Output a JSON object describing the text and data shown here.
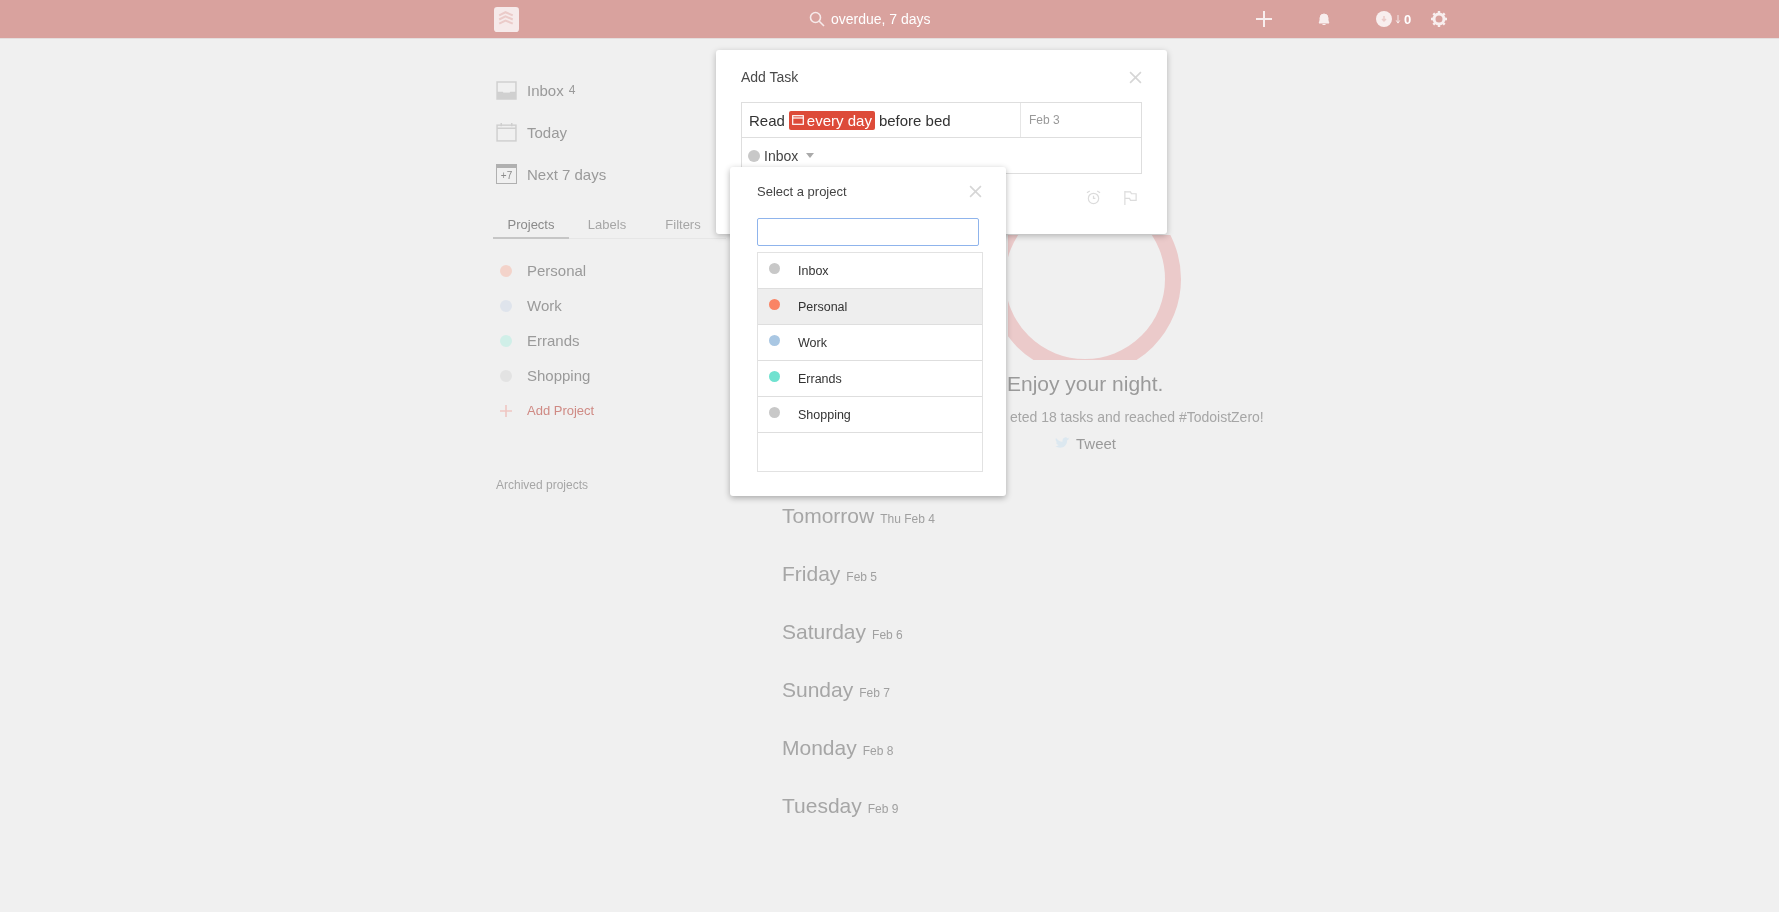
{
  "top_bar": {
    "search": {
      "placeholder": "overdue, 7 days"
    },
    "karma": "0"
  },
  "sidebar": {
    "nav": [
      {
        "kind": "inbox",
        "label": "Inbox",
        "count": "4"
      },
      {
        "kind": "today",
        "label": "Today"
      },
      {
        "kind": "week",
        "label": "Next 7 days",
        "icon_text": "+7"
      }
    ],
    "tabs": [
      {
        "label": "Projects",
        "selected": true
      },
      {
        "label": "Labels",
        "selected": false
      },
      {
        "label": "Filters",
        "selected": false
      }
    ],
    "projects": [
      {
        "name": "Personal",
        "color": "#f3d3ca"
      },
      {
        "name": "Work",
        "color": "#dfe4ec"
      },
      {
        "name": "Errands",
        "color": "#d0efe8"
      },
      {
        "name": "Shopping",
        "color": "#e3e3e3"
      }
    ],
    "add_project": "Add Project",
    "archived": "Archived projects"
  },
  "main": {
    "headline": "Enjoy your night.",
    "subtitle": "eted 18 tasks and reached #TodoistZero!",
    "tweet": "Tweet",
    "days": [
      {
        "day": "Tomorrow",
        "date": "Thu Feb 4"
      },
      {
        "day": "Friday",
        "date": "Feb 5"
      },
      {
        "day": "Saturday",
        "date": "Feb 6"
      },
      {
        "day": "Sunday",
        "date": "Feb 7"
      },
      {
        "day": "Monday",
        "date": "Feb 8"
      },
      {
        "day": "Tuesday",
        "date": "Feb 9"
      }
    ]
  },
  "add_task": {
    "title": "Add Task",
    "task": [
      {
        "kind": "plain",
        "text": "Read"
      },
      {
        "kind": "date",
        "text": "every day"
      },
      {
        "kind": "plain",
        "text": "before bed"
      }
    ],
    "due_date": "Feb 3",
    "project": "Inbox"
  },
  "project_picker": {
    "title": "Select a project",
    "items": [
      {
        "name": "Inbox",
        "color": "#c8c8c8",
        "selected": false
      },
      {
        "name": "Personal",
        "color": "#fa8465",
        "selected": true
      },
      {
        "name": "Work",
        "color": "#a9c7e3",
        "selected": false
      },
      {
        "name": "Errands",
        "color": "#70e2d0",
        "selected": false
      },
      {
        "name": "Shopping",
        "color": "#c8c8c8",
        "selected": false
      }
    ]
  }
}
